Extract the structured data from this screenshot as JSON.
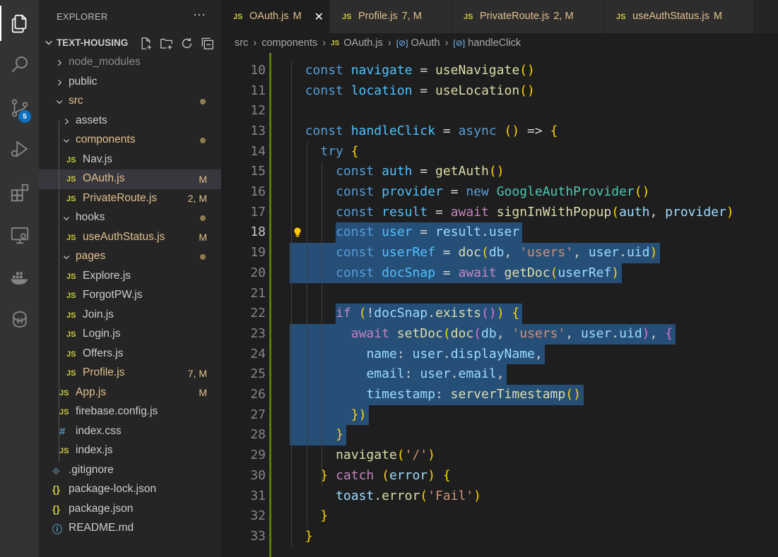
{
  "sidebar": {
    "title": "EXPLORER",
    "more": "···",
    "project": "TEXT-HOUSING",
    "items": [
      {
        "label": "node_modules",
        "type": "folder",
        "depth": 0,
        "open": false,
        "color": "dim"
      },
      {
        "label": "public",
        "type": "folder",
        "depth": 0,
        "open": false
      },
      {
        "label": "src",
        "type": "folder",
        "depth": 0,
        "open": true,
        "modified": true
      },
      {
        "label": "assets",
        "type": "folder",
        "depth": 1,
        "open": false
      },
      {
        "label": "components",
        "type": "folder",
        "depth": 1,
        "open": true,
        "modified": true
      },
      {
        "label": "Nav.js",
        "type": "js",
        "depth": 2
      },
      {
        "label": "OAuth.js",
        "type": "js",
        "depth": 2,
        "status": "M",
        "selected": true
      },
      {
        "label": "PrivateRoute.js",
        "type": "js",
        "depth": 2,
        "status": "2, M"
      },
      {
        "label": "hooks",
        "type": "folder",
        "depth": 1,
        "open": true,
        "dot": true
      },
      {
        "label": "useAuthStatus.js",
        "type": "js",
        "depth": 2,
        "status": "M"
      },
      {
        "label": "pages",
        "type": "folder",
        "depth": 1,
        "open": true,
        "modified": true
      },
      {
        "label": "Explore.js",
        "type": "js",
        "depth": 2
      },
      {
        "label": "ForgotPW.js",
        "type": "js",
        "depth": 2
      },
      {
        "label": "Join.js",
        "type": "js",
        "depth": 2
      },
      {
        "label": "Login.js",
        "type": "js",
        "depth": 2
      },
      {
        "label": "Offers.js",
        "type": "js",
        "depth": 2
      },
      {
        "label": "Profile.js",
        "type": "js",
        "depth": 2,
        "status": "7, M"
      },
      {
        "label": "App.js",
        "type": "js",
        "depth": 1,
        "status": "M"
      },
      {
        "label": "firebase.config.js",
        "type": "js",
        "depth": 1
      },
      {
        "label": "index.css",
        "type": "css",
        "depth": 1
      },
      {
        "label": "index.js",
        "type": "js",
        "depth": 1
      },
      {
        "label": ".gitignore",
        "type": "git",
        "depth": 0
      },
      {
        "label": "package-lock.json",
        "type": "json",
        "depth": 0
      },
      {
        "label": "package.json",
        "type": "json",
        "depth": 0
      },
      {
        "label": "README.md",
        "type": "info",
        "depth": 0
      }
    ]
  },
  "activity": {
    "scm_badge": "5",
    "icons": [
      "files-icon",
      "search-icon",
      "source-control-icon",
      "run-debug-icon",
      "extensions-icon",
      "remote-explorer-icon",
      "docker-icon",
      "database-icon"
    ]
  },
  "tabs": [
    {
      "name": "OAuth.js",
      "status": "M",
      "active": true
    },
    {
      "name": "Profile.js",
      "status": "7, M"
    },
    {
      "name": "PrivateRoute.js",
      "status": "2, M"
    },
    {
      "name": "useAuthStatus.js",
      "status": "M"
    }
  ],
  "breadcrumb": [
    "src",
    "components",
    "OAuth.js",
    "OAuth",
    "handleClick"
  ],
  "editor": {
    "current_line": 18,
    "lines": [
      {
        "n": "10",
        "code": "  const navigate = useNavigate()"
      },
      {
        "n": "11",
        "code": "  const location = useLocation()"
      },
      {
        "n": "12",
        "code": ""
      },
      {
        "n": "13",
        "code": "  const handleClick = async () => {"
      },
      {
        "n": "14",
        "code": "    try {"
      },
      {
        "n": "15",
        "code": "      const auth = getAuth()"
      },
      {
        "n": "16",
        "code": "      const provider = new GoogleAuthProvider()"
      },
      {
        "n": "17",
        "code": "      const result = await signInWithPopup(auth, provider)"
      },
      {
        "n": "18",
        "code": "      const user = result.user"
      },
      {
        "n": "19",
        "code": "      const userRef = doc(db, 'users', user.uid)"
      },
      {
        "n": "20",
        "code": "      const docSnap = await getDoc(userRef)"
      },
      {
        "n": "21",
        "code": ""
      },
      {
        "n": "22",
        "code": "      if (!docSnap.exists()) {"
      },
      {
        "n": "23",
        "code": "        await setDoc(doc(db, 'users', user.uid), {"
      },
      {
        "n": "24",
        "code": "          name: user.displayName,"
      },
      {
        "n": "25",
        "code": "          email: user.email,"
      },
      {
        "n": "26",
        "code": "          timestamp: serverTimestamp()"
      },
      {
        "n": "27",
        "code": "        })"
      },
      {
        "n": "28",
        "code": "      }"
      },
      {
        "n": "29",
        "code": "      navigate('/')"
      },
      {
        "n": "30",
        "code": "    } catch (error) {"
      },
      {
        "n": "31",
        "code": "      toast.error('Fail')"
      },
      {
        "n": "32",
        "code": "    }"
      },
      {
        "n": "33",
        "code": "  }"
      }
    ]
  }
}
